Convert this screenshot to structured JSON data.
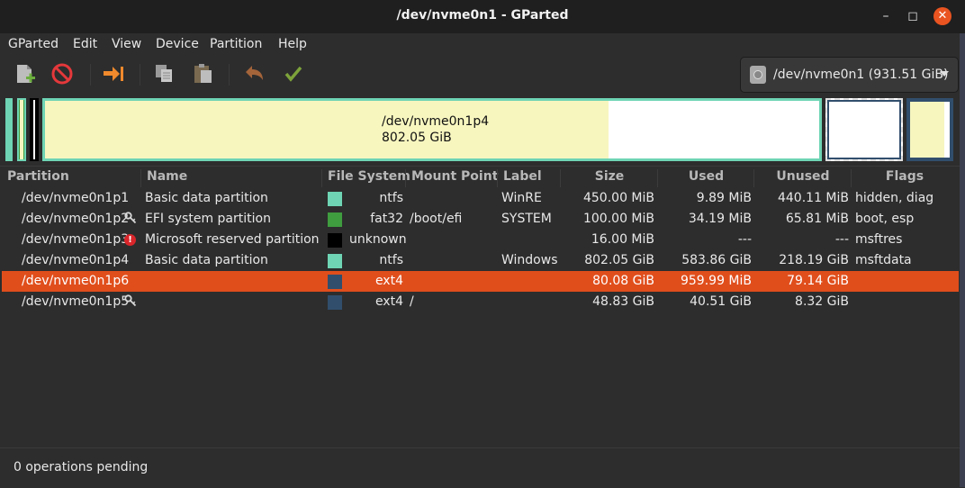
{
  "window": {
    "title": "/dev/nvme0n1 - GParted"
  },
  "menubar": [
    "GParted",
    "Edit",
    "View",
    "Device",
    "Partition",
    "Help"
  ],
  "toolbar": {
    "device_selector": "/dev/nvme0n1 (931.51 GiB)"
  },
  "diskmap": {
    "selected_partition": "/dev/nvme0n1p4",
    "selected_size": "802.05 GiB"
  },
  "table": {
    "headers": [
      "Partition",
      "Name",
      "File System",
      "Mount Point",
      "Label",
      "Size",
      "Used",
      "Unused",
      "Flags"
    ],
    "rows": [
      {
        "partition": "/dev/nvme0n1p1",
        "icon": "",
        "name": "Basic data partition",
        "fs": "ntfs",
        "fs_color": "#6ed4b4",
        "mount": "",
        "label": "WinRE",
        "size": "450.00 MiB",
        "used": "9.89 MiB",
        "unused": "440.11 MiB",
        "flags": "hidden, diag",
        "selected": false
      },
      {
        "partition": "/dev/nvme0n1p2",
        "icon": "key-icon",
        "name": "EFI system partition",
        "fs": "fat32",
        "fs_color": "#3f9c3f",
        "mount": "/boot/efi",
        "label": "SYSTEM",
        "size": "100.00 MiB",
        "used": "34.19 MiB",
        "unused": "65.81 MiB",
        "flags": "boot, esp",
        "selected": false
      },
      {
        "partition": "/dev/nvme0n1p3",
        "icon": "warning-icon",
        "name": "Microsoft reserved partition",
        "fs": "unknown",
        "fs_color": "#000000",
        "mount": "",
        "label": "",
        "size": "16.00 MiB",
        "used": "---",
        "unused": "---",
        "flags": "msftres",
        "selected": false
      },
      {
        "partition": "/dev/nvme0n1p4",
        "icon": "",
        "name": "Basic data partition",
        "fs": "ntfs",
        "fs_color": "#6ed4b4",
        "mount": "",
        "label": "Windows",
        "size": "802.05 GiB",
        "used": "583.86 GiB",
        "unused": "218.19 GiB",
        "flags": "msftdata",
        "selected": false
      },
      {
        "partition": "/dev/nvme0n1p6",
        "icon": "",
        "name": "",
        "fs": "ext4",
        "fs_color": "#314e6c",
        "mount": "",
        "label": "",
        "size": "80.08 GiB",
        "used": "959.99 MiB",
        "unused": "79.14 GiB",
        "flags": "",
        "selected": true
      },
      {
        "partition": "/dev/nvme0n1p5",
        "icon": "key-icon",
        "name": "",
        "fs": "ext4",
        "fs_color": "#314e6c",
        "mount": "/",
        "label": "",
        "size": "48.83 GiB",
        "used": "40.51 GiB",
        "unused": "8.32 GiB",
        "flags": "",
        "selected": false
      }
    ]
  },
  "status": {
    "text": "0 operations pending"
  },
  "colors": {
    "accent": "#e95420",
    "selected_row": "#e04e1c",
    "ntfs": "#6ed4b4",
    "fat32": "#3f9c3f",
    "ext4": "#314e6c"
  }
}
